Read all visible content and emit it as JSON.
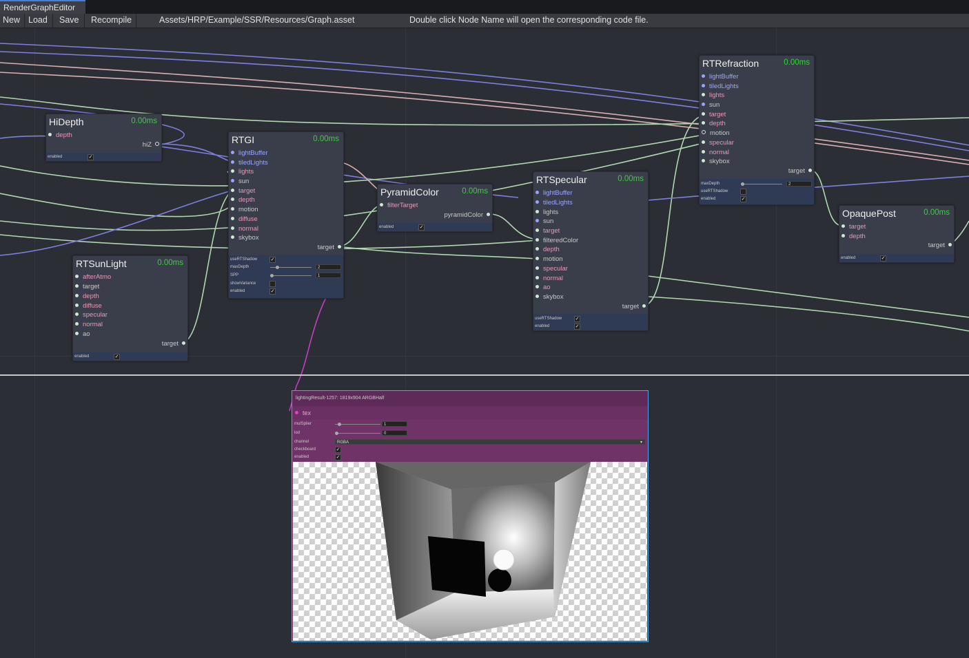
{
  "window": {
    "title": "RenderGraphEditor"
  },
  "toolbar": {
    "new": "New",
    "load": "Load",
    "save": "Save",
    "recompile": "Recompile",
    "path": "Assets/HRP/Example/SSR/Resources/Graph.asset",
    "hint": "Double click Node Name will open the corresponding code file."
  },
  "nodes": {
    "hidepth": {
      "title": "HiDepth",
      "time": "0.00ms",
      "in": [
        "depth"
      ],
      "out": "hiZ",
      "enabled": "enabled"
    },
    "rtgi": {
      "title": "RTGI",
      "time": "0.00ms",
      "in": [
        "lightBuffer",
        "tiledLights",
        "lights",
        "sun",
        "target",
        "depth",
        "motion",
        "diffuse",
        "normal",
        "skybox"
      ],
      "out": "target",
      "params": {
        "useRTShadow": "useRTShadow",
        "maxDepth": "maxDepth",
        "maxDepth_val": "2",
        "spp": "SPP",
        "spp_val": "1",
        "showVariance": "showVariance",
        "enabled": "enabled"
      }
    },
    "rtsunlight": {
      "title": "RTSunLight",
      "time": "0.00ms",
      "in": [
        "afterAtmo",
        "target",
        "depth",
        "diffuse",
        "specular",
        "normal",
        "ao"
      ],
      "out": "target",
      "enabled": "enabled"
    },
    "pyramid": {
      "title": "PyramidColor",
      "time": "0.00ms",
      "in": [
        "filterTarget"
      ],
      "out": "pyramidColor",
      "enabled": "enabled"
    },
    "rtspecular": {
      "title": "RTSpecular",
      "time": "0.00ms",
      "in": [
        "lightBuffer",
        "tiledLights",
        "lights",
        "sun",
        "target",
        "filteredColor",
        "depth",
        "motion",
        "specular",
        "normal",
        "ao",
        "skybox"
      ],
      "out": "target",
      "useRTShadow": "useRTShadow",
      "enabled": "enabled"
    },
    "rtrefraction": {
      "title": "RTRefraction",
      "time": "0.00ms",
      "in": [
        "lightBuffer",
        "tiledLights",
        "lights",
        "sun",
        "target",
        "depth",
        "motion",
        "specular",
        "normal",
        "skybox"
      ],
      "out": "target",
      "maxDepth": "maxDepth",
      "maxDepth_val": "2",
      "useRTShadow": "useRTShadow",
      "enabled": "enabled"
    },
    "opaquepost": {
      "title": "OpaquePost",
      "time": "0.00ms",
      "in": [
        "target",
        "depth"
      ],
      "out": "target",
      "enabled": "enabled"
    }
  },
  "preview": {
    "header": "lightingResult-1257: 1819x904 ARGBHalf",
    "port": "tex",
    "multiplier": "mulSplier",
    "multiplier_val": "1",
    "lod": "lod",
    "lod_val": "0",
    "channel": "channel",
    "channel_val": "RGBA",
    "checkboard": "checkboard",
    "enabled": "enabled"
  }
}
